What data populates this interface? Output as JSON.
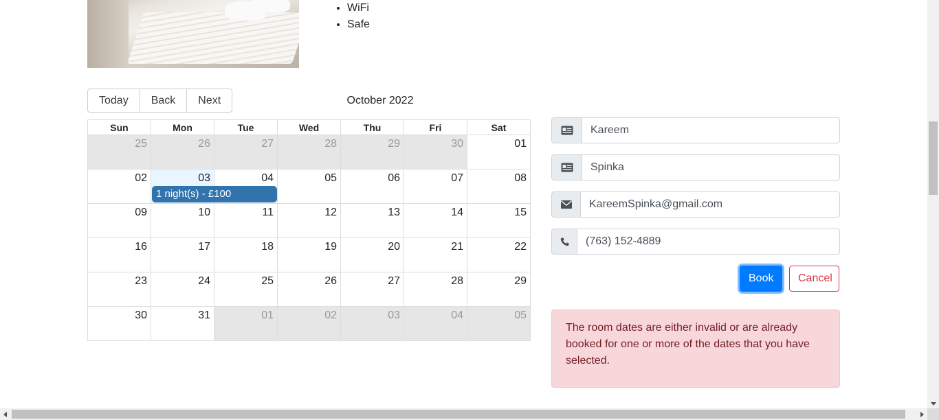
{
  "amenities": [
    "WiFi",
    "Safe"
  ],
  "calendar": {
    "toolbar": {
      "today": "Today",
      "back": "Back",
      "next": "Next"
    },
    "month_label": "October 2022",
    "weekdays": [
      "Sun",
      "Mon",
      "Tue",
      "Wed",
      "Thu",
      "Fri",
      "Sat"
    ],
    "weeks": [
      [
        {
          "d": "25",
          "off": true
        },
        {
          "d": "26",
          "off": true
        },
        {
          "d": "27",
          "off": true
        },
        {
          "d": "28",
          "off": true
        },
        {
          "d": "29",
          "off": true
        },
        {
          "d": "30",
          "off": true
        },
        {
          "d": "01",
          "off": false
        }
      ],
      [
        {
          "d": "02",
          "off": false
        },
        {
          "d": "03",
          "off": false,
          "today": true
        },
        {
          "d": "04",
          "off": false
        },
        {
          "d": "05",
          "off": false
        },
        {
          "d": "06",
          "off": false
        },
        {
          "d": "07",
          "off": false
        },
        {
          "d": "08",
          "off": false
        }
      ],
      [
        {
          "d": "09",
          "off": false
        },
        {
          "d": "10",
          "off": false
        },
        {
          "d": "11",
          "off": false
        },
        {
          "d": "12",
          "off": false
        },
        {
          "d": "13",
          "off": false
        },
        {
          "d": "14",
          "off": false
        },
        {
          "d": "15",
          "off": false
        }
      ],
      [
        {
          "d": "16",
          "off": false
        },
        {
          "d": "17",
          "off": false
        },
        {
          "d": "18",
          "off": false
        },
        {
          "d": "19",
          "off": false
        },
        {
          "d": "20",
          "off": false
        },
        {
          "d": "21",
          "off": false
        },
        {
          "d": "22",
          "off": false
        }
      ],
      [
        {
          "d": "23",
          "off": false
        },
        {
          "d": "24",
          "off": false
        },
        {
          "d": "25",
          "off": false
        },
        {
          "d": "26",
          "off": false
        },
        {
          "d": "27",
          "off": false
        },
        {
          "d": "28",
          "off": false
        },
        {
          "d": "29",
          "off": false
        }
      ],
      [
        {
          "d": "30",
          "off": false
        },
        {
          "d": "31",
          "off": false
        },
        {
          "d": "01",
          "off": true
        },
        {
          "d": "02",
          "off": true
        },
        {
          "d": "03",
          "off": true
        },
        {
          "d": "04",
          "off": true
        },
        {
          "d": "05",
          "off": true
        }
      ]
    ],
    "event": {
      "label": "1 night(s) - £100",
      "color": "#3174ad"
    }
  },
  "form": {
    "firstname": {
      "value": "Kareem",
      "icon": "id-card-icon"
    },
    "lastname": {
      "value": "Spinka",
      "icon": "id-card-icon"
    },
    "email": {
      "value": "KareemSpinka@gmail.com",
      "icon": "envelope-icon"
    },
    "phone": {
      "value": "(763) 152-4889",
      "icon": "phone-icon"
    },
    "book_label": "Book",
    "cancel_label": "Cancel"
  },
  "alert": {
    "text": "The room dates are either invalid or are already booked for one or more of the dates that you have selected."
  },
  "colors": {
    "primary": "#007bff",
    "danger": "#dc3545",
    "alert_bg": "#f8d7da",
    "alert_text": "#721c24",
    "event": "#3174ad",
    "off_range": "#e6e6e6"
  }
}
